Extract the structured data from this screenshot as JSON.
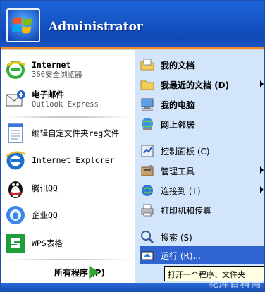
{
  "header": {
    "username": "Administrator"
  },
  "left": {
    "pinned": [
      {
        "title": "Internet",
        "subtitle": "360安全浏览器",
        "icon": "ie-360-browser-icon"
      },
      {
        "title": "电子邮件",
        "subtitle": "Outlook Express",
        "icon": "outlook-express-icon"
      }
    ],
    "recent": [
      {
        "label": "编辑自定文件夹reg文件",
        "icon": "notepad-icon"
      },
      {
        "label": "Internet Explorer",
        "icon": "ie-icon"
      },
      {
        "label": "腾讯QQ",
        "icon": "qq-penguin-icon"
      },
      {
        "label": "企业QQ",
        "icon": "enterprise-qq-icon"
      },
      {
        "label": "WPS表格",
        "icon": "wps-spreadsheet-icon"
      }
    ],
    "all_programs": "所有程序 (P)"
  },
  "right": {
    "items": [
      {
        "label": "我的文档",
        "bold": true,
        "arrow": false,
        "icon": "my-documents-icon"
      },
      {
        "label": "我最近的文档 (D)",
        "bold": true,
        "arrow": true,
        "icon": "recent-documents-icon"
      },
      {
        "label": "我的电脑",
        "bold": true,
        "arrow": false,
        "icon": "my-computer-icon"
      },
      {
        "label": "网上邻居",
        "bold": true,
        "arrow": false,
        "icon": "network-places-icon"
      },
      {
        "label": "控制面板 (C)",
        "bold": false,
        "arrow": false,
        "icon": "control-panel-icon"
      },
      {
        "label": "管理工具",
        "bold": false,
        "arrow": true,
        "icon": "admin-tools-icon"
      },
      {
        "label": "连接到 (T)",
        "bold": false,
        "arrow": true,
        "icon": "connect-to-icon"
      },
      {
        "label": "打印机和传真",
        "bold": false,
        "arrow": false,
        "icon": "printer-fax-icon"
      },
      {
        "label": "搜索 (S)",
        "bold": false,
        "arrow": false,
        "icon": "search-icon"
      },
      {
        "label": "运行 (R)...",
        "bold": false,
        "arrow": false,
        "icon": "run-icon"
      }
    ]
  },
  "tooltip": {
    "text": "打开一个程序、文件夹"
  },
  "watermark": "花库百科网",
  "colors": {
    "header": "#1757c8",
    "accent_orange": "#ef8a2a",
    "right_pane": "#d3e5fa",
    "highlight": "#2f63d2"
  }
}
